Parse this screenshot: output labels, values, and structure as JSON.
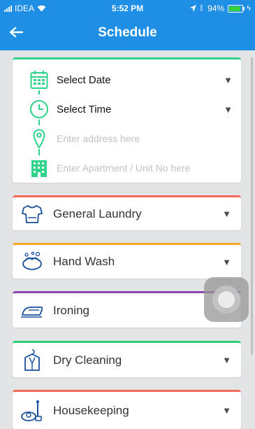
{
  "status_bar": {
    "carrier": "IDEA",
    "time": "5:52 PM",
    "battery": "94%"
  },
  "header": {
    "title": "Schedule"
  },
  "form": {
    "date_label": "Select Date",
    "time_label": "Select Time",
    "address_placeholder": "Enter address here",
    "apartment_placeholder": "Enter Apartment / Unit No here",
    "accent": "#2fd38a"
  },
  "services": [
    {
      "label": "General Laundry",
      "icon": "shirt-icon",
      "color": "#f26b5b"
    },
    {
      "label": "Hand Wash",
      "icon": "hand-wash-icon",
      "color": "#f5a623"
    },
    {
      "label": "Ironing",
      "icon": "iron-icon",
      "color": "#8e44ad"
    },
    {
      "label": "Dry Cleaning",
      "icon": "dry-cleaning-icon",
      "color": "#2ecc71"
    },
    {
      "label": "Housekeeping",
      "icon": "housekeeping-icon",
      "color": "#f26b5b"
    }
  ],
  "colors": {
    "header": "#1e8fe5",
    "background": "#e3e4e6"
  }
}
